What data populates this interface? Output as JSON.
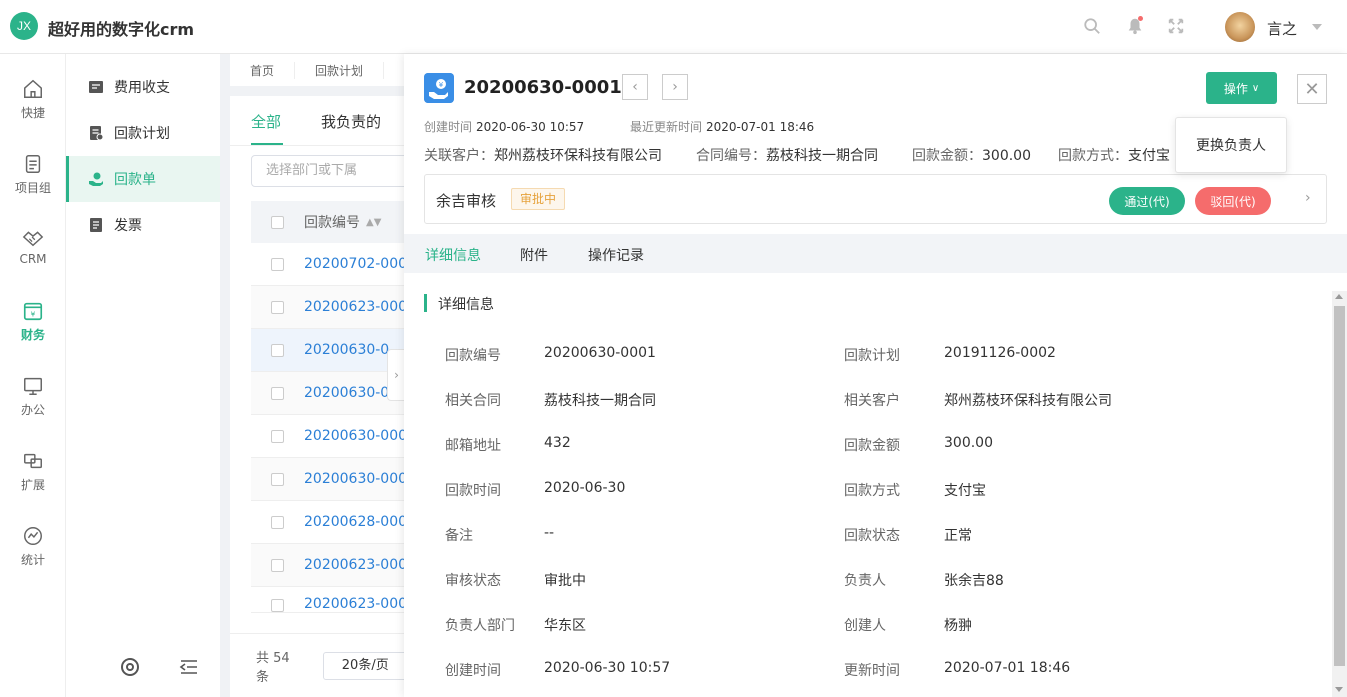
{
  "header": {
    "logo_text": "JX",
    "title": "超好用的数字化crm",
    "username": "言之",
    "icons": [
      "search-icon",
      "bell-icon",
      "fullscreen-icon",
      "chevron-down-icon"
    ],
    "notice_dot_color": "#f56c6c"
  },
  "nav": {
    "items": [
      {
        "label": "快捷",
        "icon": "home-icon"
      },
      {
        "label": "项目组",
        "icon": "document-icon"
      },
      {
        "label": "CRM",
        "icon": "handshake-icon"
      },
      {
        "label": "财务",
        "icon": "finance-icon",
        "active": true
      },
      {
        "label": "办公",
        "icon": "monitor-icon"
      },
      {
        "label": "扩展",
        "icon": "extend-icon"
      },
      {
        "label": "统计",
        "icon": "chart-icon"
      }
    ],
    "active_color": "#2bb38a"
  },
  "submenu": {
    "items": [
      {
        "label": "费用收支",
        "icon": "expense-icon"
      },
      {
        "label": "回款计划",
        "icon": "plan-icon"
      },
      {
        "label": "回款单",
        "icon": "receipt-icon",
        "active": true
      },
      {
        "label": "发票",
        "icon": "invoice-icon"
      }
    ]
  },
  "breadcrumb": [
    "首页",
    "回款计划"
  ],
  "list": {
    "tabs": [
      "全部",
      "我负责的"
    ],
    "dept_placeholder": "选择部门或下属",
    "column_header": "回款编号",
    "rows": [
      "20200702-000",
      "20200623-000",
      "20200630-0",
      "20200630-0",
      "20200630-000",
      "20200630-000",
      "20200628-000",
      "20200623-000",
      "20200623-000"
    ],
    "pager_total": "共 54 条",
    "page_size": "20条/页"
  },
  "detail": {
    "title": "20200630-0001",
    "created_label": "创建时间",
    "created_value": "2020-06-30 10:57",
    "updated_label": "最近更新时间",
    "updated_value": "2020-07-01 18:46",
    "operate_label": "操作",
    "dropdown_item": "更换负责人",
    "summary": {
      "customer_label": "关联客户：",
      "customer_value": "郑州荔枝环保科技有限公司",
      "contract_label": "合同编号：",
      "contract_value": "荔枝科技一期合同",
      "amount_label": "回款金额：",
      "amount_value": "300.00",
      "method_label": "回款方式：",
      "method_value": "支付宝"
    },
    "audit": {
      "title": "余吉审核",
      "status": "审批中",
      "pass_label": "通过(代)",
      "reject_label": "驳回(代)"
    },
    "tabs": [
      "详细信息",
      "附件",
      "操作记录"
    ],
    "section_title": "详细信息",
    "fields_left": [
      {
        "label": "回款编号",
        "value": "20200630-0001"
      },
      {
        "label": "相关合同",
        "value": "荔枝科技一期合同"
      },
      {
        "label": "邮箱地址",
        "value": "432"
      },
      {
        "label": "回款时间",
        "value": "2020-06-30"
      },
      {
        "label": "备注",
        "value": "--"
      },
      {
        "label": "审核状态",
        "value": "审批中"
      },
      {
        "label": "负责人部门",
        "value": "华东区"
      },
      {
        "label": "创建时间",
        "value": "2020-06-30 10:57"
      }
    ],
    "fields_right": [
      {
        "label": "回款计划",
        "value": "20191126-0002"
      },
      {
        "label": "相关客户",
        "value": "郑州荔枝环保科技有限公司"
      },
      {
        "label": "回款金额",
        "value": "300.00"
      },
      {
        "label": "回款方式",
        "value": "支付宝"
      },
      {
        "label": "回款状态",
        "value": "正常"
      },
      {
        "label": "负责人",
        "value": "张余吉88"
      },
      {
        "label": "创建人",
        "value": "杨翀"
      },
      {
        "label": "更新时间",
        "value": "2020-07-01 18:46"
      }
    ]
  },
  "colors": {
    "accent": "#2bb38a",
    "danger": "#f56c6c",
    "link": "#2b7fd6",
    "pending": "#e6a23c"
  }
}
